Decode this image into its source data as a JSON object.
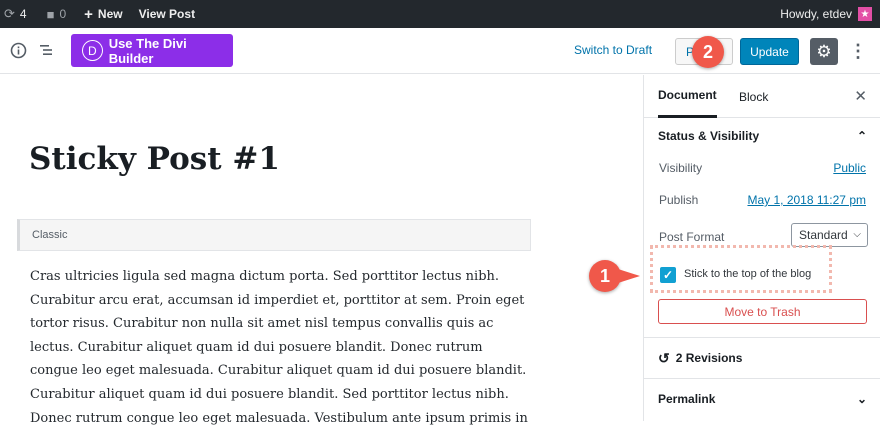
{
  "adminbar": {
    "updates_count": "4",
    "comments_count": "0",
    "new_label": "New",
    "view_post_label": "View Post",
    "howdy_label": "Howdy, etdev"
  },
  "toolbar": {
    "divi_label": "Use The Divi Builder",
    "divi_letter": "D",
    "switch_draft_label": "Switch to Draft",
    "preview_label": "P",
    "update_label": "Update"
  },
  "callouts": {
    "badge_1": "1",
    "badge_2": "2"
  },
  "editor": {
    "post_title": "Sticky Post #1",
    "block_label": "Classic",
    "body_lines": [
      "Cras ultricies ligula sed magna dictum porta. Sed porttitor lectus nibh.",
      "Curabitur arcu erat, accumsan id imperdiet et, porttitor at sem. Proin eget",
      "tortor risus. Curabitur non nulla sit amet nisl tempus convallis quis ac",
      "lectus. Curabitur aliquet quam id dui posuere blandit. Donec rutrum",
      "congue leo eget malesuada. Curabitur aliquet quam id dui posuere blandit.",
      "Curabitur aliquet quam id dui posuere blandit. Sed porttitor lectus nibh.",
      "Donec rutrum congue leo eget malesuada. Vestibulum ante ipsum primis in"
    ]
  },
  "sidebar": {
    "tabs": [
      "Document",
      "Block"
    ],
    "status_heading": "Status & Visibility",
    "visibility_label": "Visibility",
    "visibility_value": "Public",
    "publish_label": "Publish",
    "publish_value": "May 1, 2018 11:27 pm",
    "post_format_label": "Post Format",
    "post_format_value": "Standard",
    "sticky_label": "Stick to the top of the blog",
    "sticky_checked": true,
    "trash_label": "Move to Trash",
    "revisions_label": "2 Revisions",
    "permalink_label": "Permalink"
  },
  "colors": {
    "accent_purple": "#8c2ee8",
    "update_blue": "#0085ba",
    "callout_red": "#f0584a",
    "checkbox_blue": "#11a0d2"
  }
}
